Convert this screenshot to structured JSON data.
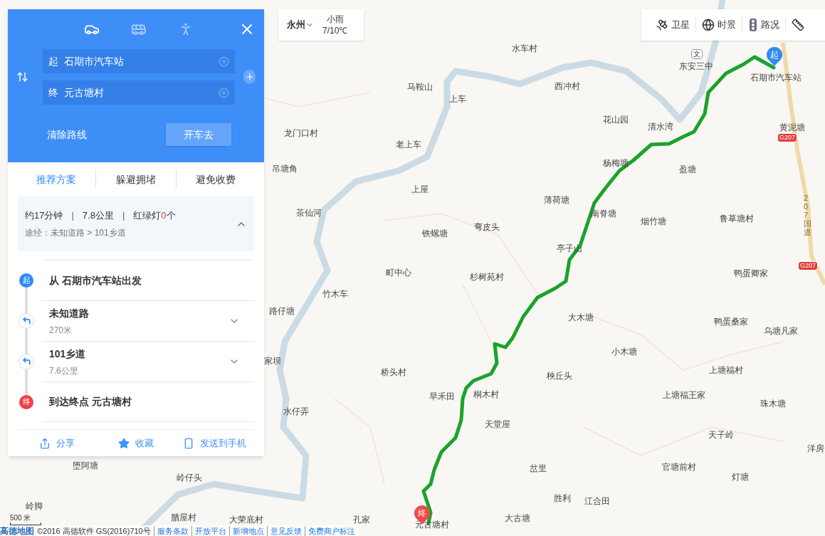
{
  "route_panel": {
    "modes": [
      {
        "kind": "car",
        "selected": true
      },
      {
        "kind": "bus",
        "selected": false
      },
      {
        "kind": "walk",
        "selected": false
      }
    ],
    "start": {
      "tag": "起",
      "value": "石期市汽车站"
    },
    "end": {
      "tag": "终",
      "value": "元古塘村"
    },
    "clear_button": "清除路线",
    "go_button": "开车去",
    "options": [
      {
        "label": "推荐方案",
        "selected": true
      },
      {
        "label": "躲避拥堵",
        "selected": false
      },
      {
        "label": "避免收费",
        "selected": false
      }
    ],
    "summary": {
      "separator": "|",
      "time": "约17分钟",
      "distance": "7.8公里",
      "lights_label": "红绿灯",
      "lights_count": "0",
      "lights_unit": "个",
      "via": "途经：未知道路 > 101乡道",
      "expanded": true
    },
    "steps": [
      {
        "kind": "start",
        "badge": "起",
        "title": "从 石期市汽车站出发"
      },
      {
        "kind": "turn",
        "title": "未知道路",
        "distance": "270米"
      },
      {
        "kind": "turn",
        "title": "101乡道",
        "distance": "7.6公里"
      },
      {
        "kind": "end",
        "badge": "终",
        "title": "到达终点 元古塘村"
      }
    ],
    "actions": [
      {
        "kind": "share",
        "label": "分享"
      },
      {
        "kind": "star",
        "label": "收藏"
      },
      {
        "kind": "phone",
        "label": "发送到手机"
      }
    ]
  },
  "weather": {
    "city": "永州",
    "condition": "小雨",
    "temperature": "7/10℃"
  },
  "layers": [
    {
      "kind": "satellite",
      "label": "卫星"
    },
    {
      "kind": "globe",
      "label": "时景"
    },
    {
      "kind": "traffic",
      "label": "路况"
    },
    {
      "kind": "ruler"
    }
  ],
  "map": {
    "labels": [
      "水车村",
      "马鞍山",
      "上车",
      "西冲村",
      "东安三中",
      "石期市汽车站",
      "花山园",
      "清水湾",
      "黄泥塘",
      "龙门口村",
      "老上车",
      "杨梅塘",
      "吊塘角",
      "盈塘",
      "上屋",
      "茶仙河",
      "薄荷塘",
      "南脊塘",
      "烟竹塘",
      "鲁草塘村",
      "铁螺塘",
      "弯皮头",
      "亭子山",
      "町中心",
      "杉树苑村",
      "鸭蛋卿家",
      "竹木车",
      "路仔塘",
      "大木塘",
      "鸭蛋桑家",
      "乌塘凡家",
      "小木塘",
      "家坝",
      "桥头村",
      "上塘福村",
      "早禾田",
      "桐木村",
      "秧丘头",
      "上塘福王家",
      "珠木塘",
      "水仔弄",
      "天堂屋",
      "天子岭",
      "洋房",
      "岔里",
      "官塘前村",
      "灯塘",
      "胜利",
      "江合田",
      "孔家",
      "元古塘村",
      "大古塘",
      "堕阿塘",
      "岭仔头",
      "岭脚",
      "腊屋村",
      "大荣底村"
    ],
    "school_sign": "文",
    "road_shields": [
      "G207",
      "G207"
    ],
    "road_name": "207国道",
    "start_marker": "起",
    "end_marker": "终",
    "scale": "500 米",
    "logo": "高德地图",
    "copyright": "©2016 高德软件 GS(2016)710号",
    "footer_links": [
      "服务条款",
      "开放平台",
      "新增地点",
      "意见反馈",
      "免费商户标注"
    ]
  }
}
